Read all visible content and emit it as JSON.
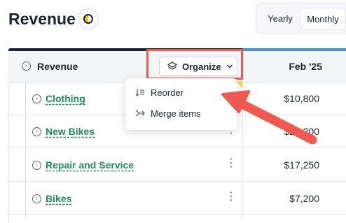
{
  "header": {
    "title": "Revenue",
    "period_toggle": {
      "options": [
        "Yearly",
        "Monthly"
      ],
      "selected": "Monthly"
    }
  },
  "table": {
    "column_header": "Revenue",
    "month": "Feb '25",
    "organize_label": "Organize",
    "rows": [
      {
        "label": "Clothing",
        "value": "$10,800"
      },
      {
        "label": "New Bikes",
        "value": "$25,200"
      },
      {
        "label": "Repair and Service",
        "value": "$17,250"
      },
      {
        "label": "Bikes",
        "value": "$7,200"
      }
    ]
  },
  "organize_menu": {
    "items": [
      {
        "label": "Reorder",
        "icon": "reorder-icon"
      },
      {
        "label": "Merge items",
        "icon": "merge-icon"
      }
    ]
  },
  "colors": {
    "accent_dark": "#1d2230",
    "accent_blue": "#4a90e2",
    "link_green": "#1f8c5a",
    "annotation_red": "#ef5a50"
  }
}
